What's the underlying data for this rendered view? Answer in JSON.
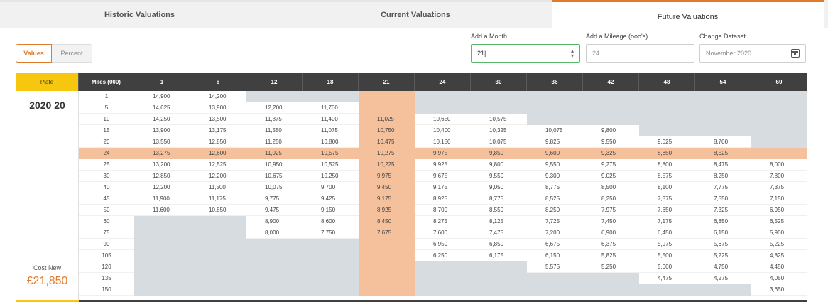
{
  "tabs": [
    {
      "label": "Historic Valuations"
    },
    {
      "label": "Current Valuations"
    },
    {
      "label": "Future Valuations"
    }
  ],
  "toggle": {
    "values_label": "Values",
    "percent_label": "Percent"
  },
  "controls": {
    "month_label": "Add a Month",
    "month_value": "21",
    "mileage_label": "Add a Mileage (ooo's)",
    "mileage_placeholder": "24",
    "dataset_label": "Change Dataset",
    "dataset_value": "November 2020"
  },
  "plate": {
    "header": "Plate",
    "value": "2020 20",
    "cost_label": "Cost New",
    "cost_value": "£21,850"
  },
  "miles_header": "Miles (000)",
  "months": [
    "1",
    "6",
    "12",
    "18",
    "21",
    "24",
    "30",
    "36",
    "42",
    "48",
    "54",
    "60"
  ],
  "selected_month": "21",
  "selected_miles": "24",
  "miles": [
    "1",
    "5",
    "10",
    "15",
    "20",
    "24",
    "25",
    "30",
    "40",
    "45",
    "50",
    "60",
    "75",
    "90",
    "105",
    "120",
    "135",
    "150"
  ],
  "values": [
    [
      "14,900",
      "14,200",
      "",
      "",
      "",
      "",
      "",
      "",
      "",
      "",
      "",
      ""
    ],
    [
      "14,625",
      "13,900",
      "12,200",
      "11,700",
      "",
      "",
      "",
      "",
      "",
      "",
      "",
      ""
    ],
    [
      "14,250",
      "13,500",
      "11,875",
      "11,400",
      "11,025",
      "10,650",
      "10,575",
      "",
      "",
      "",
      "",
      ""
    ],
    [
      "13,900",
      "13,175",
      "11,550",
      "11,075",
      "10,750",
      "10,400",
      "10,325",
      "10,075",
      "9,800",
      "",
      "",
      ""
    ],
    [
      "13,550",
      "12,850",
      "11,250",
      "10,800",
      "10,475",
      "10,150",
      "10,075",
      "9,825",
      "9,550",
      "9,025",
      "8,700",
      ""
    ],
    [
      "13,275",
      "12,600",
      "11,025",
      "10,575",
      "10,275",
      "9,975",
      "9,850",
      "9,600",
      "9,325",
      "8,850",
      "8,525",
      ""
    ],
    [
      "13,200",
      "12,525",
      "10,950",
      "10,525",
      "10,225",
      "9,925",
      "9,800",
      "9,550",
      "9,275",
      "8,800",
      "8,475",
      "8,000"
    ],
    [
      "12,850",
      "12,200",
      "10,675",
      "10,250",
      "9,975",
      "9,675",
      "9,550",
      "9,300",
      "9,025",
      "8,575",
      "8,250",
      "7,800"
    ],
    [
      "12,200",
      "11,500",
      "10,075",
      "9,700",
      "9,450",
      "9,175",
      "9,050",
      "8,775",
      "8,500",
      "8,100",
      "7,775",
      "7,375"
    ],
    [
      "11,900",
      "11,175",
      "9,775",
      "9,425",
      "9,175",
      "8,925",
      "8,775",
      "8,525",
      "8,250",
      "7,875",
      "7,550",
      "7,150"
    ],
    [
      "11,600",
      "10,850",
      "9,475",
      "9,150",
      "8,925",
      "8,700",
      "8,550",
      "8,250",
      "7,975",
      "7,650",
      "7,325",
      "6,950"
    ],
    [
      "",
      "",
      "8,900",
      "8,600",
      "8,450",
      "8,275",
      "8,125",
      "7,725",
      "7,450",
      "7,175",
      "6,850",
      "6,525"
    ],
    [
      "",
      "",
      "8,000",
      "7,750",
      "7,675",
      "7,600",
      "7,475",
      "7,200",
      "6,900",
      "6,450",
      "6,150",
      "5,900"
    ],
    [
      "",
      "",
      "",
      "",
      "",
      "6,950",
      "6,850",
      "6,675",
      "6,375",
      "5,975",
      "5,675",
      "5,225"
    ],
    [
      "",
      "",
      "",
      "",
      "",
      "6,250",
      "6,175",
      "6,150",
      "5,825",
      "5,500",
      "5,225",
      "4,825"
    ],
    [
      "",
      "",
      "",
      "",
      "",
      "",
      "",
      "5,575",
      "5,250",
      "5,000",
      "4,750",
      "4,450"
    ],
    [
      "",
      "",
      "",
      "",
      "",
      "",
      "",
      "",
      "",
      "4,475",
      "4,275",
      "4,050"
    ],
    [
      "",
      "",
      "",
      "",
      "",
      "",
      "",
      "",
      "",
      "",
      "",
      "3,650"
    ]
  ]
}
